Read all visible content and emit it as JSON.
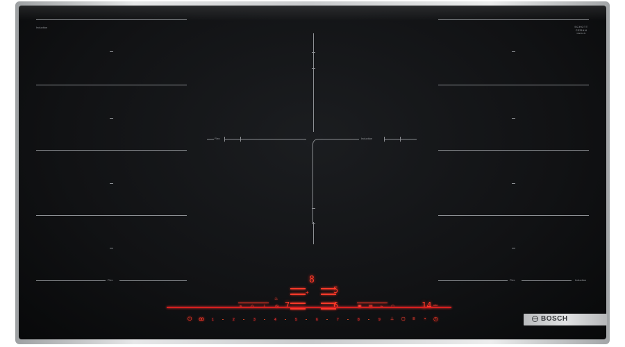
{
  "appliance": {
    "model_text": "Induction",
    "brand": "BOSCH",
    "glass_maker_line1": "SCHOTT",
    "glass_maker_line2": "CERAN",
    "glass_maker_line3": "CERAN"
  },
  "cooking_zones": {
    "left_flex_label": "Flex",
    "center_label": "Induction",
    "right_flex_label": "Flex",
    "right_bottom_label": "Induction",
    "bottom_left_label": "Flex"
  },
  "display": {
    "power_level_top": "8",
    "power_left_a": "5",
    "power_left_b": "7",
    "power_right": "6",
    "timer_value": "14",
    "timer_unit": "min"
  },
  "controls": {
    "scale": [
      "1",
      "2",
      "3",
      "4",
      "5",
      "6",
      "7",
      "8",
      "9"
    ],
    "icons": {
      "power": "power-icon",
      "child_lock": "child-lock-icon",
      "wipe_protect": "wipe-protect-icon",
      "hood": "hood-icon",
      "flex_left": "flex-zone-icon",
      "move": "move-icon",
      "fry": "fry-sensor-icon",
      "boost": "boost-icon",
      "timer": "timer-icon",
      "stopwatch": "stopwatch-icon"
    }
  },
  "colors": {
    "glass": "#111214",
    "display_red": "#ff3a2a",
    "frame": "#c9cbcd"
  }
}
